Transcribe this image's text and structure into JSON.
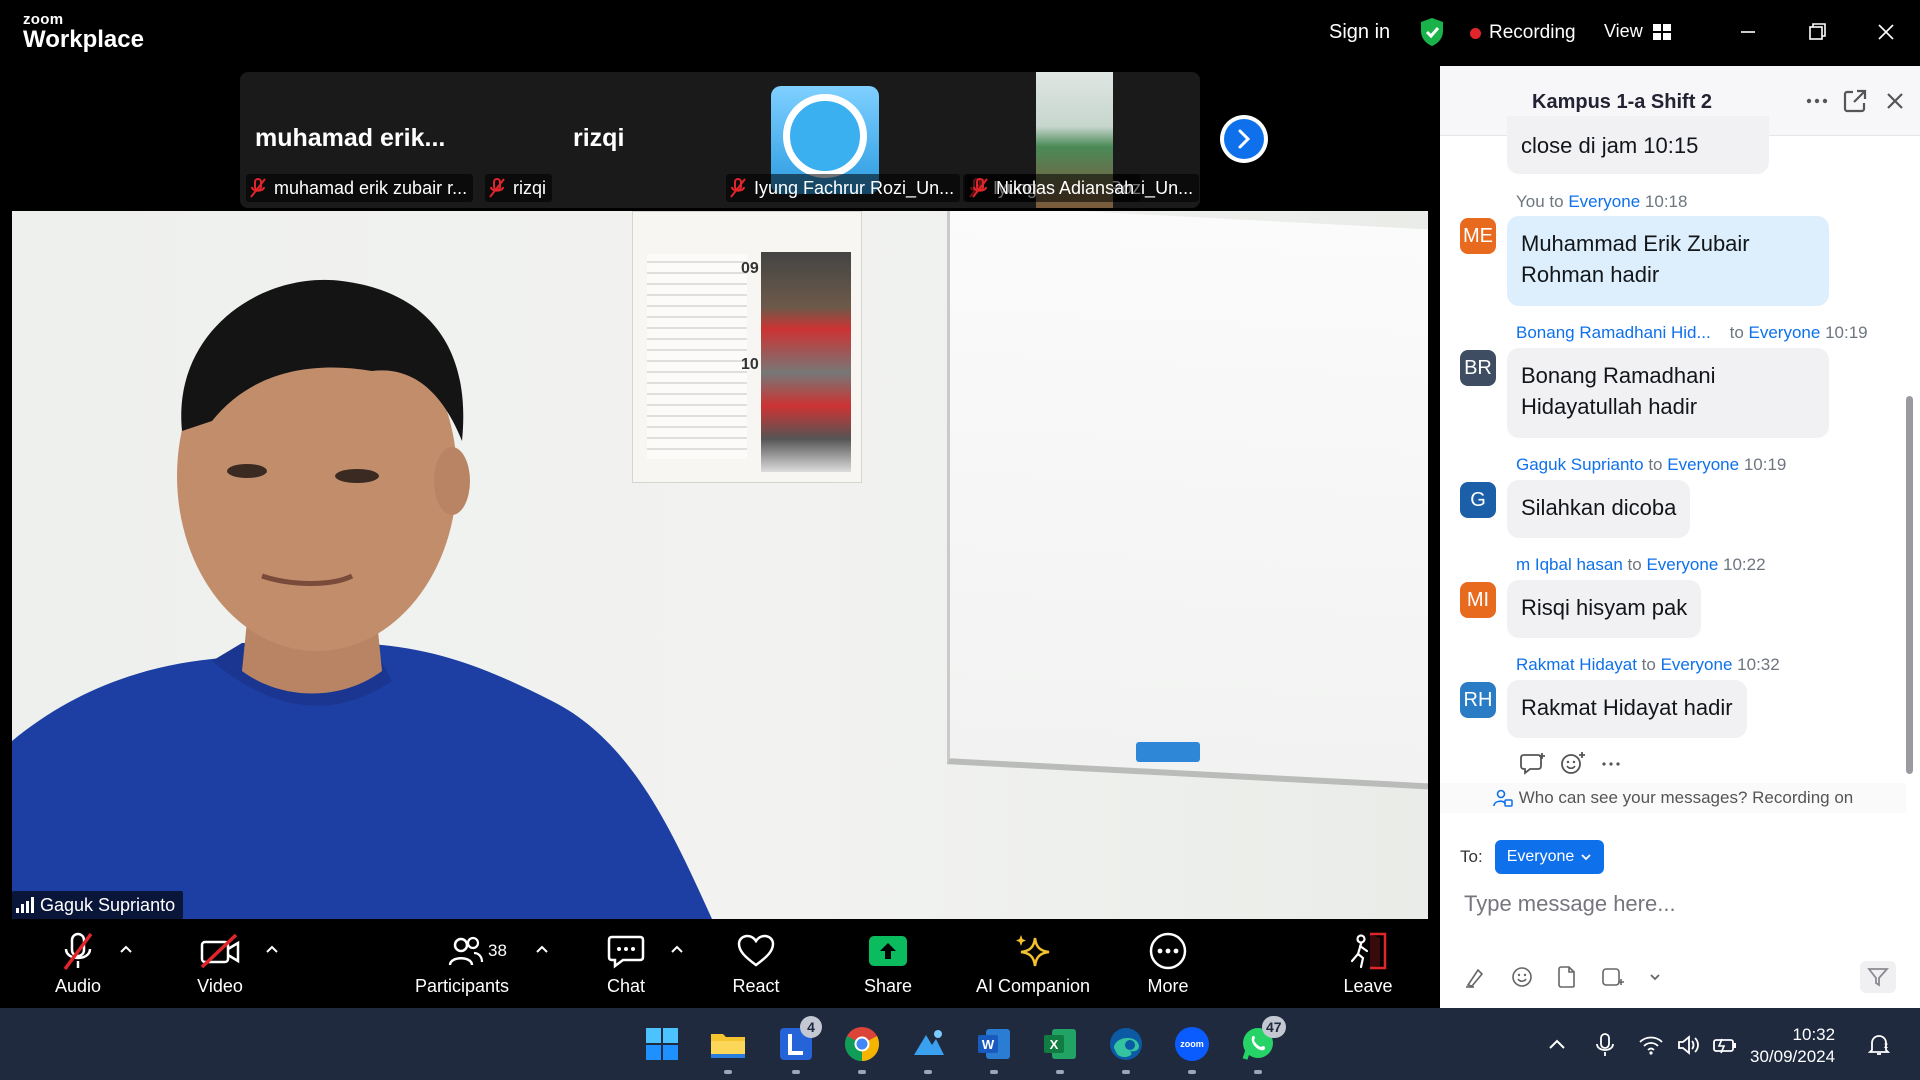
{
  "app": {
    "logo_small": "zoom",
    "logo_big": "Workplace"
  },
  "titlebar": {
    "signin": "Sign in",
    "recording": "Recording",
    "view": "View"
  },
  "filmstrip": {
    "tiles": [
      {
        "bigname": "muhamad  erik...",
        "caption": "muhamad erik zubair r..."
      },
      {
        "bigname": "rizqi",
        "caption": "rizqi"
      },
      {
        "caption": "Iyung Fachrur Rozi_Un..."
      },
      {
        "caption": "Nikolas Adiansah"
      }
    ]
  },
  "video": {
    "speaker": "Gaguk Suprianto",
    "calendar_day_1": "09",
    "calendar_day_2": "10"
  },
  "toolbar": {
    "audio": "Audio",
    "video": "Video",
    "participants": "Participants",
    "participants_count": "38",
    "chat": "Chat",
    "react": "React",
    "share": "Share",
    "ai": "AI Companion",
    "more": "More",
    "leave": "Leave"
  },
  "chat": {
    "title": "Kampus 1-a Shift 2",
    "messages": [
      {
        "text": "close di jam 10:15"
      },
      {
        "initials": "ME",
        "color": "#e86a1f",
        "sender": "You",
        "to_word": "to",
        "target": "Everyone",
        "time": "10:18",
        "text_1": "Muhammad Erik Zubair",
        "text_2": "Rohman hadir"
      },
      {
        "initials": "BR",
        "color": "#3e4d61",
        "sender": "Bonang Ramadhani Hid...",
        "to_word": "to",
        "target": "Everyone",
        "time": "10:19",
        "text_1": "Bonang Ramadhani",
        "text_2": "Hidayatullah hadir"
      },
      {
        "initials": "G",
        "color": "#1b5fa8",
        "sender": "Gaguk Suprianto",
        "to_word": "to",
        "target": "Everyone",
        "time": "10:19",
        "text_1": "Silahkan dicoba"
      },
      {
        "initials": "MI",
        "color": "#e86a1f",
        "sender": "m Iqbal hasan",
        "to_word": "to",
        "target": "Everyone",
        "time": "10:22",
        "text_1": "Risqi hisyam pak"
      },
      {
        "initials": "RH",
        "color": "#2a7cc4",
        "sender": "Rakmat Hidayat",
        "to_word": "to",
        "target": "Everyone",
        "time": "10:32",
        "text_1": "Rakmat Hidayat hadir"
      }
    ],
    "privacy": "Who can see your messages? Recording on",
    "to_label": "To:",
    "to_value": "Everyone",
    "placeholder": "Type message here..."
  },
  "taskbar": {
    "badge_l": "4",
    "badge_wa": "47",
    "time": "10:32",
    "date": "30/09/2024"
  },
  "colors": {
    "accent": "#0e71eb",
    "record": "#e0262b",
    "share": "#0bbc5e",
    "leave": "#e0262b"
  }
}
